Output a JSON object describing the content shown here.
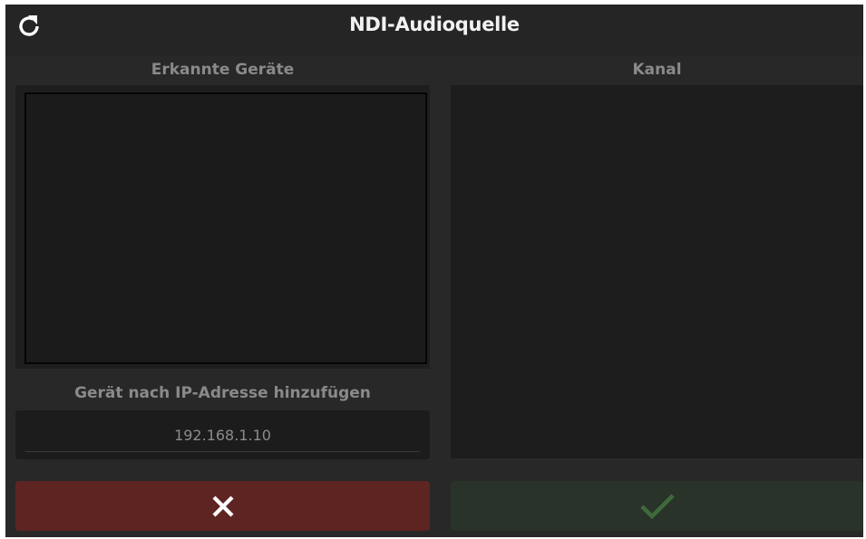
{
  "header": {
    "title": "NDI-Audioquelle",
    "refresh_icon": "refresh-icon"
  },
  "devices": {
    "label": "Erkannte Geräte",
    "items": []
  },
  "channel": {
    "label": "Kanal",
    "items": []
  },
  "add_ip": {
    "label": "Gerät nach IP-Adresse hinzufügen",
    "placeholder": "192.168.1.10",
    "value": ""
  },
  "actions": {
    "cancel_icon": "close-icon",
    "confirm_icon": "check-icon"
  },
  "colors": {
    "background": "#282828",
    "cancel": "#5e2422",
    "confirm": "#29332a",
    "confirm_check": "#3f6a3b",
    "cancel_x": "#ffffff"
  }
}
